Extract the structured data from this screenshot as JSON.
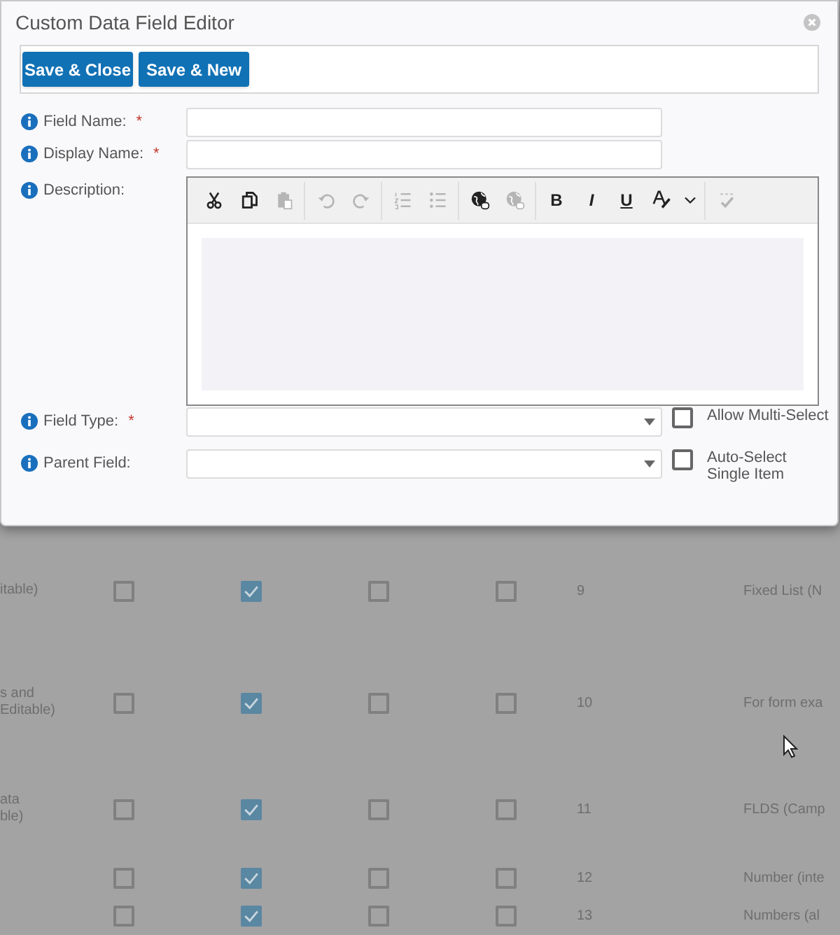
{
  "dialog": {
    "title": "Custom Data Field Editor",
    "buttons": [
      "Save & Close",
      "Save & New"
    ],
    "fields": [
      {
        "kind": "text",
        "label": "Field Name:",
        "required_mark": "*"
      },
      {
        "kind": "text",
        "label": "Display Name:",
        "required_mark": "*"
      },
      {
        "kind": "richtext",
        "label": "Description:"
      },
      {
        "kind": "select",
        "label": "Field Type:",
        "required_mark": "*",
        "option": {
          "label": "Allow Multi-Select",
          "checked": false
        }
      },
      {
        "kind": "select",
        "label": "Parent Field:",
        "option": {
          "label": "Auto-Select Single Item",
          "checked": false
        }
      }
    ],
    "editor_toolbar": [
      [
        {
          "kind": "cut",
          "disabled": false
        },
        {
          "kind": "copy",
          "disabled": false
        },
        {
          "kind": "paste",
          "disabled": true
        }
      ],
      [
        {
          "kind": "undo",
          "disabled": true
        },
        {
          "kind": "redo",
          "disabled": true
        }
      ],
      [
        {
          "kind": "numbered-list",
          "disabled": true
        },
        {
          "kind": "bullet-list",
          "disabled": true
        }
      ],
      [
        {
          "kind": "link",
          "disabled": false
        },
        {
          "kind": "unlink",
          "disabled": true
        }
      ],
      [
        {
          "kind": "bold",
          "label": "B",
          "disabled": false
        },
        {
          "kind": "italic",
          "label": "I",
          "disabled": false
        },
        {
          "kind": "underline",
          "label": "U",
          "disabled": false
        },
        {
          "kind": "font-color",
          "disabled": false
        },
        {
          "kind": "dropdown",
          "disabled": false
        }
      ],
      [
        {
          "kind": "spellcheck",
          "disabled": true
        }
      ]
    ]
  },
  "table": {
    "rows": [
      {
        "column_1": "itable)",
        "checks": [
          false,
          true,
          false,
          false
        ],
        "column_6": "9",
        "column_7": "Fixed List (N"
      },
      {
        "column_1": "s and\nEditable)",
        "checks": [
          false,
          true,
          false,
          false
        ],
        "column_6": "10",
        "column_7": "For form exa"
      },
      {
        "column_1": "ata\nble)",
        "checks": [
          false,
          true,
          false,
          false
        ],
        "column_6": "11",
        "column_7": "FLDS (Camp"
      },
      {
        "checks": [
          false,
          true,
          false,
          false
        ],
        "column_6": "12",
        "column_7": "Number (inte"
      },
      {
        "checks": [
          false,
          true,
          false,
          false
        ],
        "column_6": "13",
        "column_7": "Numbers (al"
      }
    ]
  }
}
